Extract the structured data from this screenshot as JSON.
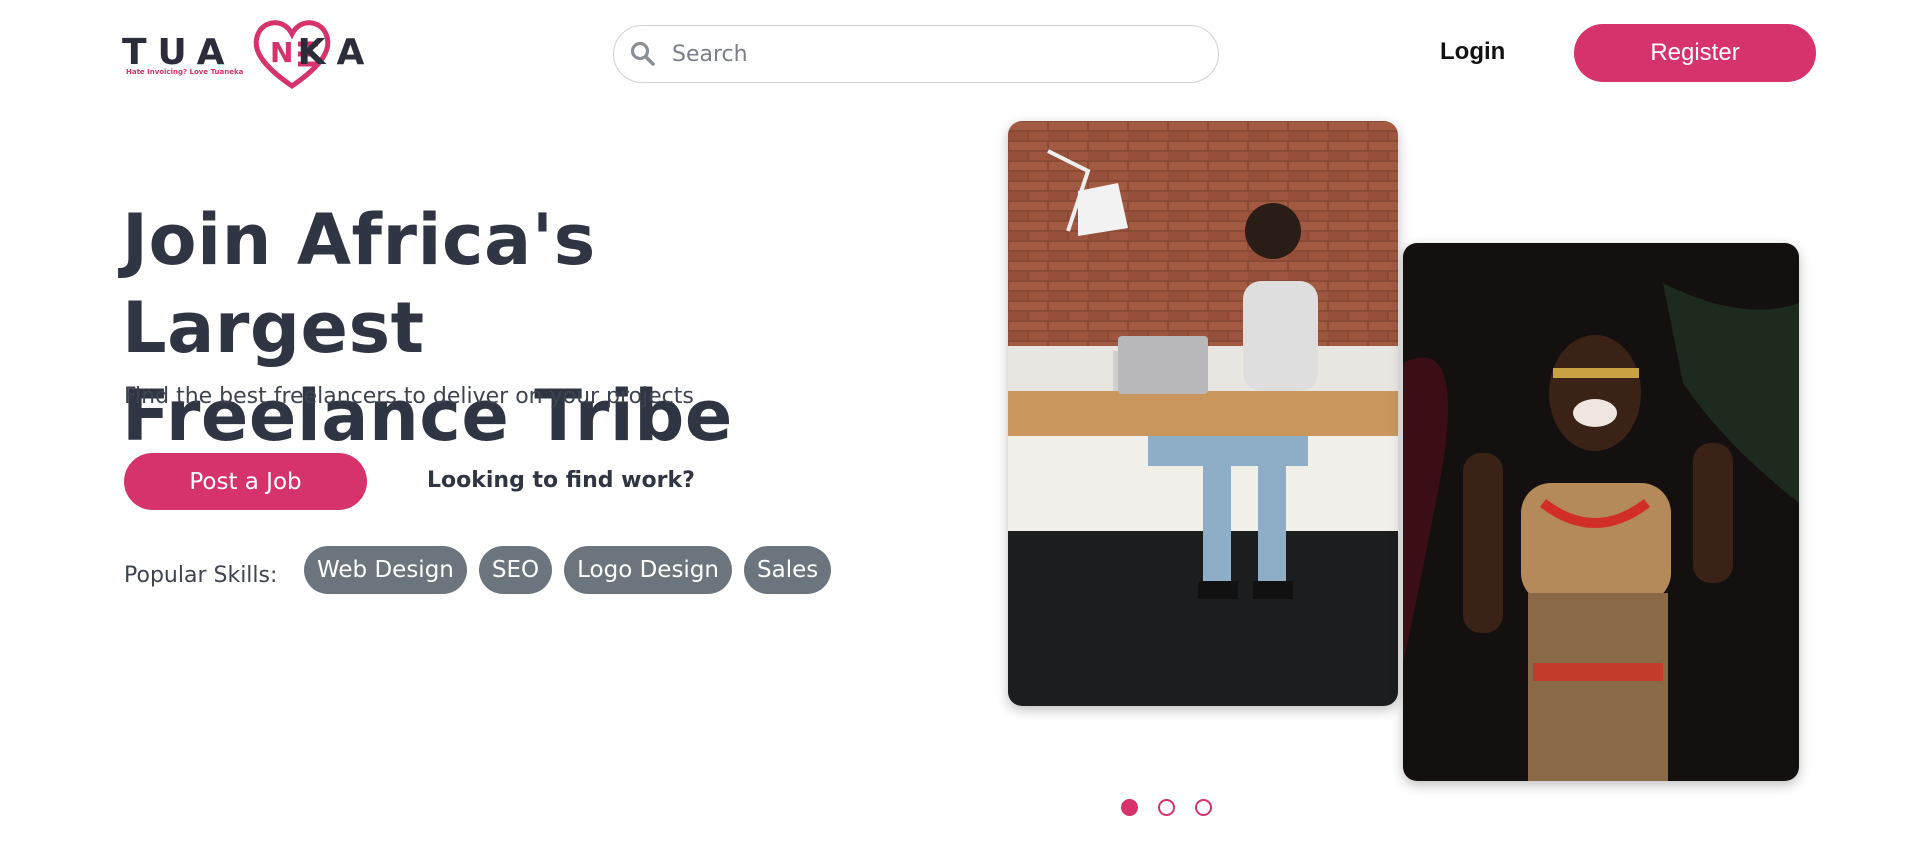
{
  "brand": {
    "logo_text_left": "TUA",
    "logo_text_right": "KA",
    "tagline": "Hate Invoicing? Love Tuaneka",
    "accent_color": "#d6336c"
  },
  "header": {
    "search_placeholder": "Search",
    "search_icon": "search-icon",
    "login_label": "Login",
    "register_label": "Register"
  },
  "hero": {
    "title_line1": "Join Africa's Largest",
    "title_line2": "Freelance Tribe",
    "subtitle": "Find the best freelancers to deliver on your projects",
    "post_job_label": "Post a Job",
    "find_work_label": "Looking to find work?",
    "skills_label": "Popular Skills:",
    "skills": [
      "Web Design",
      "SEO",
      "Logo Design",
      "Sales"
    ]
  },
  "carousel": {
    "slides": 3,
    "active_index": 0
  }
}
